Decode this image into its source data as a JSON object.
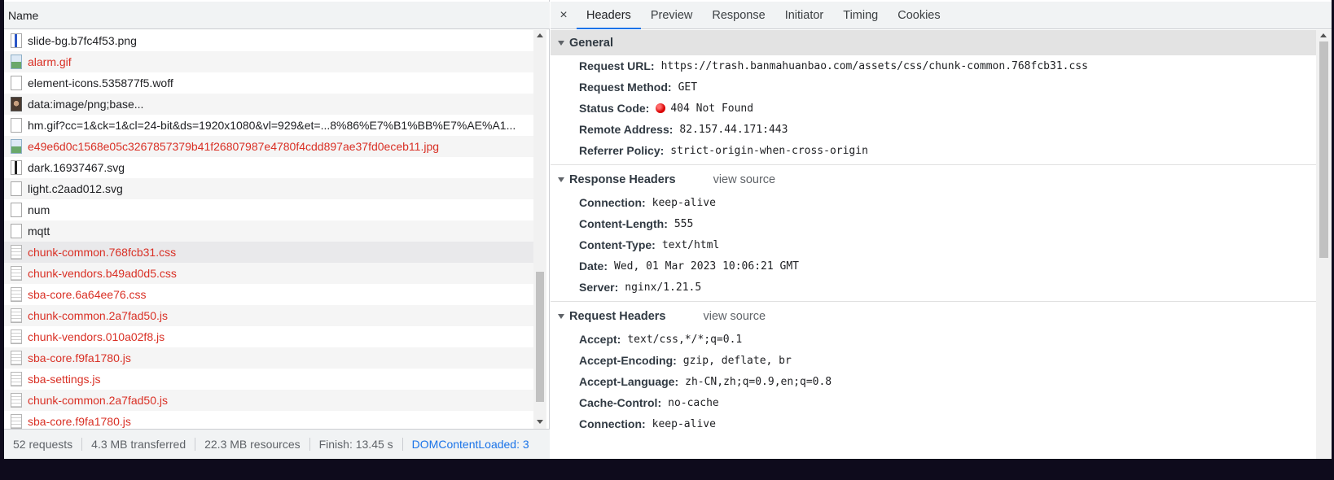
{
  "left_panel": {
    "header": "Name",
    "rows": [
      {
        "label": "slide-bg.b7fc4f53.png",
        "icon": "image-file-icon",
        "error": false
      },
      {
        "label": "alarm.gif",
        "icon": "broken-image-icon",
        "error": true
      },
      {
        "label": "element-icons.535877f5.woff",
        "icon": "file-icon",
        "error": false
      },
      {
        "label": "data:image/png;base...",
        "icon": "image-thumbnail-icon",
        "error": false
      },
      {
        "label": "hm.gif?cc=1&ck=1&cl=24-bit&ds=1920x1080&vl=929&et=...8%86%E7%B1%BB%E7%AE%A1...",
        "icon": "file-icon",
        "error": false
      },
      {
        "label": "e49e6d0c1568e05c3267857379b41f26807987e4780f4cdd897ae37fd0eceb11.jpg",
        "icon": "broken-image-icon",
        "error": true
      },
      {
        "label": "dark.16937467.svg",
        "icon": "svg-file-icon",
        "error": false
      },
      {
        "label": "light.c2aad012.svg",
        "icon": "file-icon",
        "error": false
      },
      {
        "label": "num",
        "icon": "file-icon",
        "error": false
      },
      {
        "label": "mqtt",
        "icon": "file-icon",
        "error": false
      },
      {
        "label": "chunk-common.768fcb31.css",
        "icon": "css-file-icon",
        "error": true,
        "selected": true
      },
      {
        "label": "chunk-vendors.b49ad0d5.css",
        "icon": "css-file-icon",
        "error": true
      },
      {
        "label": "sba-core.6a64ee76.css",
        "icon": "css-file-icon",
        "error": true
      },
      {
        "label": "chunk-common.2a7fad50.js",
        "icon": "js-file-icon",
        "error": true
      },
      {
        "label": "chunk-vendors.010a02f8.js",
        "icon": "js-file-icon",
        "error": true
      },
      {
        "label": "sba-core.f9fa1780.js",
        "icon": "js-file-icon",
        "error": true
      },
      {
        "label": "sba-settings.js",
        "icon": "js-file-icon",
        "error": true
      },
      {
        "label": "chunk-common.2a7fad50.js",
        "icon": "js-file-icon",
        "error": true
      },
      {
        "label": "sba-core.f9fa1780.js",
        "icon": "js-file-icon",
        "error": true
      }
    ],
    "status": {
      "requests": "52 requests",
      "transferred": "4.3 MB transferred",
      "resources": "22.3 MB resources",
      "finish": "Finish: 13.45 s",
      "dcl": "DOMContentLoaded: 3"
    }
  },
  "right_panel": {
    "close_glyph": "×",
    "tabs": [
      "Headers",
      "Preview",
      "Response",
      "Initiator",
      "Timing",
      "Cookies"
    ],
    "active_tab": "Headers",
    "general": {
      "title": "General",
      "items": [
        {
          "key": "Request URL:",
          "value": "https://trash.banmahuanbao.com/assets/css/chunk-common.768fcb31.css"
        },
        {
          "key": "Request Method:",
          "value": "GET"
        },
        {
          "key": "Status Code:",
          "value": "404 Not Found"
        },
        {
          "key": "Remote Address:",
          "value": "82.157.44.171:443"
        },
        {
          "key": "Referrer Policy:",
          "value": "strict-origin-when-cross-origin"
        }
      ]
    },
    "response_headers": {
      "title": "Response Headers",
      "view_source": "view source",
      "items": [
        {
          "key": "Connection:",
          "value": "keep-alive"
        },
        {
          "key": "Content-Length:",
          "value": "555"
        },
        {
          "key": "Content-Type:",
          "value": "text/html"
        },
        {
          "key": "Date:",
          "value": "Wed, 01 Mar 2023 10:06:21 GMT"
        },
        {
          "key": "Server:",
          "value": "nginx/1.21.5"
        }
      ]
    },
    "request_headers": {
      "title": "Request Headers",
      "view_source": "view source",
      "items": [
        {
          "key": "Accept:",
          "value": "text/css,*/*;q=0.1"
        },
        {
          "key": "Accept-Encoding:",
          "value": "gzip, deflate, br"
        },
        {
          "key": "Accept-Language:",
          "value": "zh-CN,zh;q=0.9,en;q=0.8"
        },
        {
          "key": "Cache-Control:",
          "value": "no-cache"
        },
        {
          "key": "Connection:",
          "value": "keep-alive"
        }
      ]
    }
  },
  "colors": {
    "error_text": "#d93025",
    "accent": "#1a73e8",
    "status_dot": "#d90000"
  }
}
